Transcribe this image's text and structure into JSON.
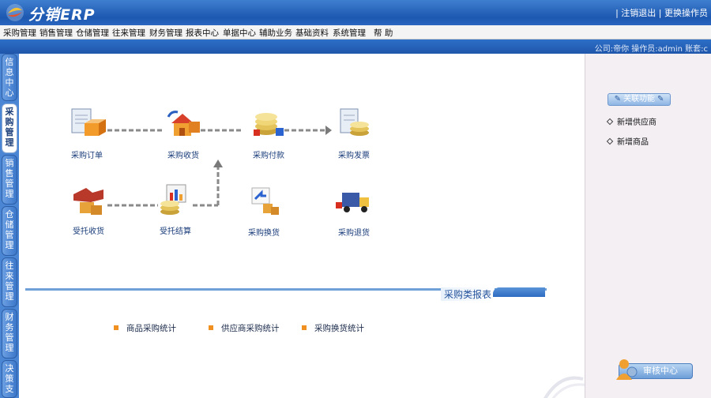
{
  "app": {
    "title": "分销ERP"
  },
  "top_links": {
    "logout": "注销退出",
    "separator": "|",
    "change_operator": "更换操作员"
  },
  "menu": [
    "采购管理",
    "销售管理",
    "仓储管理",
    "往来管理",
    "财务管理",
    "报表中心",
    "单据中心",
    "辅助业务",
    "基础资料",
    "系统管理",
    "帮 助"
  ],
  "info_bar": {
    "text": "公司:帝你   操作员:admin   账套:c"
  },
  "sidebar_tabs": [
    {
      "label": "信息中心",
      "active": false
    },
    {
      "label": "采购管理",
      "active": true
    },
    {
      "label": "销售管理",
      "active": false
    },
    {
      "label": "仓储管理",
      "active": false
    },
    {
      "label": "往来管理",
      "active": false
    },
    {
      "label": "财务管理",
      "active": false
    },
    {
      "label": "决策支",
      "active": false
    }
  ],
  "flow": {
    "purchase_order": "采购订单",
    "purchase_receive": "采购收货",
    "purchase_payment": "采购付款",
    "purchase_invoice": "采购发票",
    "consign_receive": "受托收货",
    "consign_settle": "受托结算",
    "purchase_exchange": "采购换货",
    "purchase_return": "采购退货"
  },
  "reports": {
    "section_title": "采购类报表",
    "items": [
      "商品采购统计",
      "供应商采购统计",
      "采购换货统计"
    ]
  },
  "quick": {
    "title": "关联功能",
    "items": [
      "新增供应商",
      "新增商品"
    ],
    "audit": "审核中心"
  },
  "colors": {
    "brand_blue": "#1d58b0",
    "accent_orange": "#f09020",
    "panel_bg": "#f3eff3"
  },
  "icons": {
    "logo": "app-logo",
    "order": "document-box-icon",
    "receive": "house-box-icon",
    "payment": "coins-icon",
    "invoice": "invoice-coins-icon",
    "consign": "handshake-box-icon",
    "settle": "chart-coins-icon",
    "exchange": "arrow-boxes-icon",
    "return": "truck-icon"
  }
}
